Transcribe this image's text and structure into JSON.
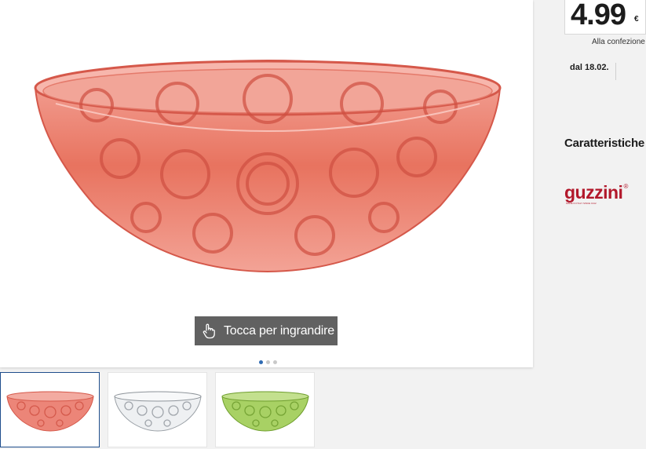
{
  "gallery": {
    "zoom_label": "Tocca per ingrandire",
    "main_color": "#e56a5c",
    "dots": {
      "count": 3,
      "active": 1
    },
    "thumbnails": [
      {
        "color": "#e56a5c",
        "selected": true
      },
      {
        "color": "#d9dcdf",
        "selected": false
      },
      {
        "color": "#9ccb55",
        "selected": false
      }
    ]
  },
  "price": {
    "value": "4.99",
    "currency": "€",
    "asterisk": "*",
    "unit": "Alla confezione"
  },
  "availability": {
    "date": "dal 18.02."
  },
  "features": {
    "title": "Caratteristiche"
  },
  "brand": {
    "name": "guzzini",
    "tagline": "MADE IN ITALY SINCE 1912",
    "mark": "®"
  },
  "colors": {
    "accent": "#2f6bb3",
    "brand": "#b2182b"
  }
}
